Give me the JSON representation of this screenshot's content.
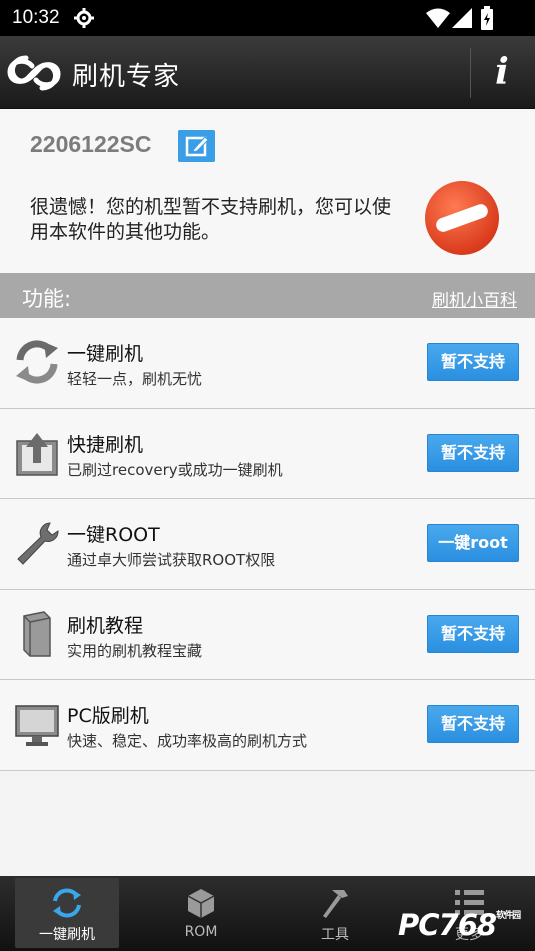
{
  "status_bar": {
    "time": "10:32",
    "icons": [
      "gear-icon",
      "wifi-icon",
      "signal-icon",
      "battery-icon"
    ]
  },
  "app_bar": {
    "title": "刷机专家",
    "logo": "app-logo",
    "info_label": "i"
  },
  "device": {
    "model": "2206122SC",
    "message": "很遗憾！您的机型暂不支持刷机，您可以使用本软件的其他功能。",
    "status_icon": "not-supported-icon"
  },
  "functions_header": {
    "label": "功能:",
    "wiki_link": "刷机小百科"
  },
  "functions": [
    {
      "title": "一键刷机",
      "subtitle": "轻轻一点，刷机无忧",
      "button": "暂不支持",
      "icon": "refresh-arrows-icon"
    },
    {
      "title": "快捷刷机",
      "subtitle": "已刷过recovery或成功一键刷机",
      "button": "暂不支持",
      "icon": "upload-box-icon"
    },
    {
      "title": "一键ROOT",
      "subtitle": "通过卓大师尝试获取ROOT权限",
      "button": "一键root",
      "icon": "wrench-icon"
    },
    {
      "title": "刷机教程",
      "subtitle": "实用的刷机教程宝藏",
      "button": "暂不支持",
      "icon": "book-icon"
    },
    {
      "title": "PC版刷机",
      "subtitle": "快速、稳定、成功率极高的刷机方式",
      "button": "暂不支持",
      "icon": "monitor-icon"
    }
  ],
  "bottom_nav": [
    {
      "label": "一键刷机",
      "icon": "refresh-icon",
      "active": true
    },
    {
      "label": "ROM",
      "icon": "cube-icon",
      "active": false
    },
    {
      "label": "工具",
      "icon": "hammer-icon",
      "active": false
    },
    {
      "label": "更多",
      "icon": "list-icon",
      "active": false
    }
  ],
  "watermark": {
    "text": "PC768",
    "sub": "软件园"
  },
  "colors": {
    "accent": "#3a9ee6",
    "header": "#a8a8a8",
    "appbar": "#2b2b2b"
  }
}
